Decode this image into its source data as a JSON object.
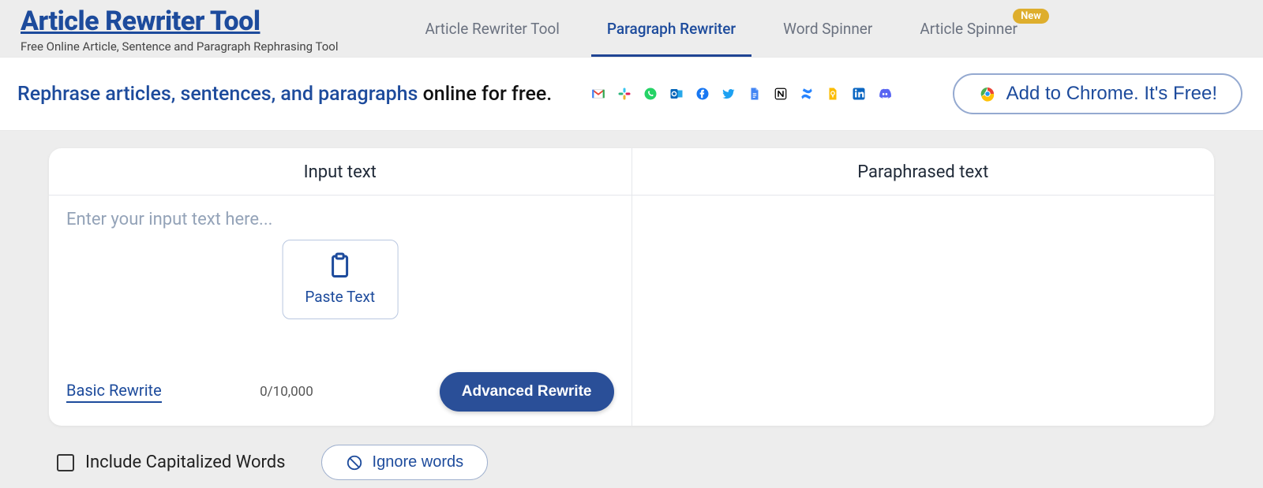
{
  "brand": {
    "title": "Article Rewriter Tool",
    "subtitle": "Free Online Article, Sentence and Paragraph Rephrasing Tool"
  },
  "nav": [
    {
      "label": "Article Rewriter Tool",
      "active": false,
      "badge": null
    },
    {
      "label": "Paragraph Rewriter",
      "active": true,
      "badge": null
    },
    {
      "label": "Word Spinner",
      "active": false,
      "badge": null
    },
    {
      "label": "Article Spinner",
      "active": false,
      "badge": "New"
    }
  ],
  "promo": {
    "highlight": "Rephrase articles, sentences, and paragraphs",
    "rest": " online for free.",
    "chrome_label": "Add to Chrome. It's Free!"
  },
  "share_icons": [
    {
      "name": "gmail-icon"
    },
    {
      "name": "slack-icon"
    },
    {
      "name": "whatsapp-icon"
    },
    {
      "name": "outlook-icon"
    },
    {
      "name": "facebook-icon"
    },
    {
      "name": "twitter-icon"
    },
    {
      "name": "docs-icon"
    },
    {
      "name": "notion-icon"
    },
    {
      "name": "confluence-icon"
    },
    {
      "name": "keep-icon"
    },
    {
      "name": "linkedin-icon"
    },
    {
      "name": "discord-icon"
    }
  ],
  "panes": {
    "input_title": "Input text",
    "output_title": "Paraphrased text",
    "placeholder": "Enter your input text here...",
    "paste_label": "Paste Text",
    "basic_label": "Basic Rewrite",
    "advanced_label": "Advanced Rewrite",
    "counter": "0/10,000"
  },
  "options": {
    "capitalized_label": "Include Capitalized Words",
    "ignore_label": "Ignore words"
  }
}
